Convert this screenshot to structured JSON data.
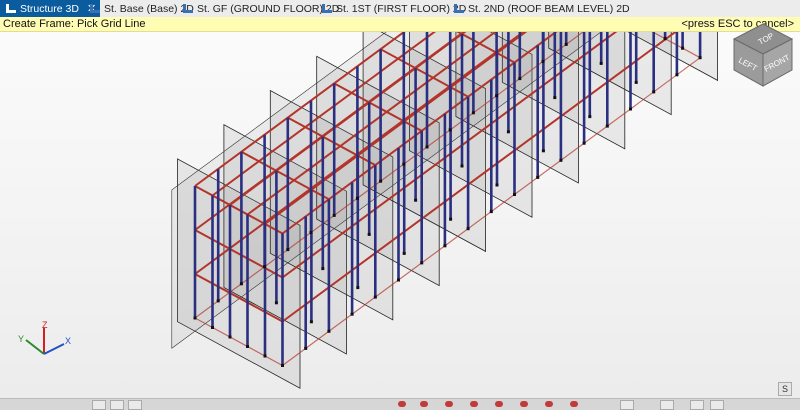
{
  "tabs": [
    {
      "label": "Structure 3D",
      "active": true,
      "close": "✕"
    },
    {
      "label": "St. Base (Base) 2D",
      "active": false
    },
    {
      "label": "St. GF (GROUND FLOOR) 2D",
      "active": false
    },
    {
      "label": "St. 1ST (FIRST FLOOR) 2D",
      "active": false
    },
    {
      "label": "St. 2ND (ROOF BEAM LEVEL) 2D",
      "active": false
    }
  ],
  "infobar": {
    "prompt": "Create Frame: Pick Grid Line",
    "hint": "<press ESC to cancel>"
  },
  "viewcube": {
    "top": "TOP",
    "left": "LEFT",
    "front": "FRONT"
  },
  "axes": {
    "x": "X",
    "y": "Y",
    "z": "Z"
  },
  "corner_icon": "S",
  "colors": {
    "beam": "#b3352a",
    "column": "#2a2f80",
    "frame_pane": "#7d7d7d",
    "active_tab": "#0b5c9e",
    "infobar": "#fffcb4"
  }
}
